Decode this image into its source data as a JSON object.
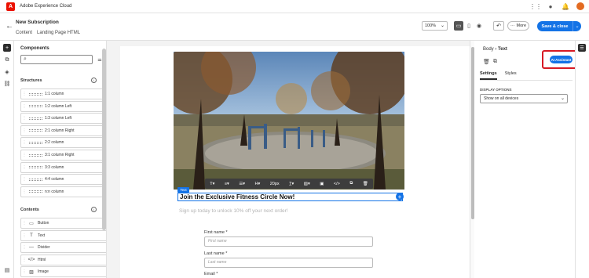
{
  "app": {
    "title": "Adobe Experience Cloud",
    "logo_letter": "A"
  },
  "header": {
    "title": "New Subscription",
    "breadcrumb": [
      "Content",
      "Landing Page HTML"
    ],
    "zoom": "100%",
    "more_label": "More",
    "save_label": "Save & close"
  },
  "components": {
    "title": "Components",
    "search_placeholder": "",
    "structures_title": "Structures",
    "structures": [
      "1:1 column",
      "1:2 column Left",
      "1:3 column Left",
      "2:1 column Right",
      "2:2 column",
      "3:1 column Right",
      "3:3 column",
      "4:4 column",
      "n:n column"
    ],
    "contents_title": "Contents",
    "contents": [
      {
        "label": "Button",
        "icon": "button-icon"
      },
      {
        "label": "Text",
        "icon": "text-icon"
      },
      {
        "label": "Divider",
        "icon": "divider-icon"
      },
      {
        "label": "Html",
        "icon": "code-icon"
      },
      {
        "label": "Image",
        "icon": "image-icon"
      }
    ]
  },
  "canvas": {
    "text_tag": "Text",
    "heading": "Join the Exclusive Fitness Circle Now!",
    "subheading": "Sign up today to unlock 10% off your next order!",
    "toolbar": {
      "font_size": "20px"
    },
    "form": {
      "first_name_label": "First name",
      "first_name_placeholder": "First name",
      "last_name_label": "Last name",
      "last_name_placeholder": "Last name",
      "email_label": "Email",
      "required_mark": "*"
    }
  },
  "properties": {
    "breadcrumb_root": "Body",
    "breadcrumb_current": "Text",
    "ai_assistant_label": "AI Assistant",
    "tabs": [
      "Settings",
      "Styles"
    ],
    "display_options_label": "DISPLAY OPTIONS",
    "display_value": "Show on all devices"
  },
  "colors": {
    "accent": "#1473e6",
    "highlight_box": "#d71a24",
    "brand": "#eb1000"
  }
}
